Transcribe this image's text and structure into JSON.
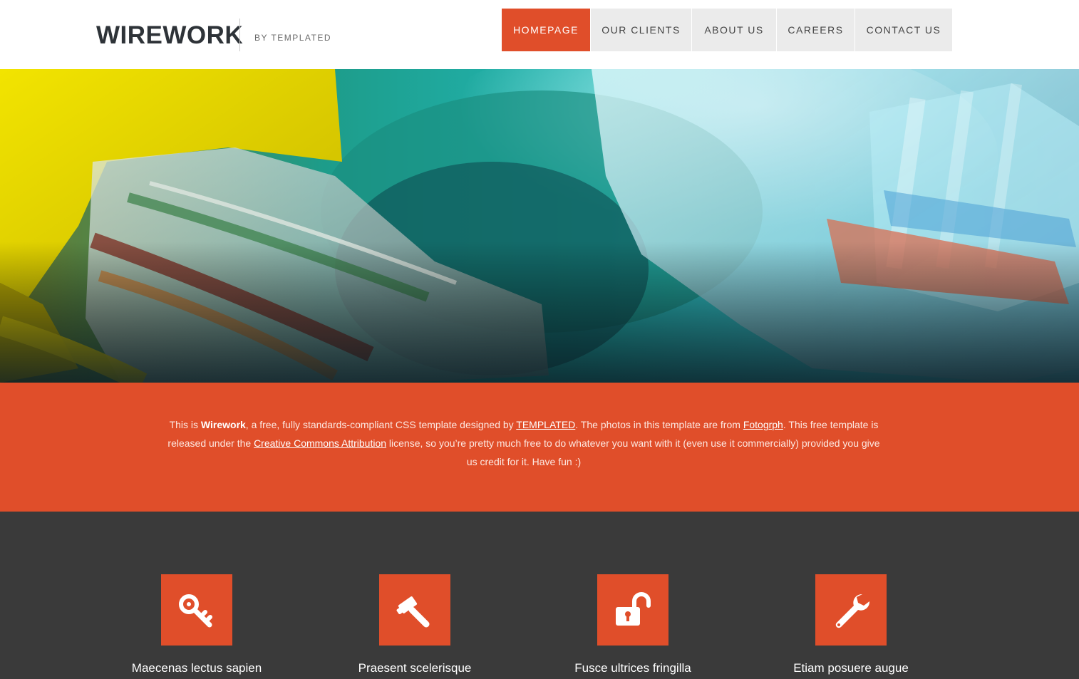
{
  "header": {
    "logo": "WIREWORK",
    "byline": "BY TEMPLATED"
  },
  "nav": {
    "items": [
      {
        "label": "HOMEPAGE"
      },
      {
        "label": "OUR CLIENTS"
      },
      {
        "label": "ABOUT US"
      },
      {
        "label": "CAREERS"
      },
      {
        "label": "CONTACT US"
      }
    ],
    "active": "HOMEPAGE"
  },
  "intro": {
    "p1": "This is ",
    "brand": "Wirework",
    "p2": ", a free, fully standards-compliant CSS template designed by ",
    "link_templated": "TEMPLATED",
    "p3": ". The photos in this template are from ",
    "link_fotogrph": "Fotogrph",
    "p4": ". This free template is released under the ",
    "link_cc": "Creative Commons Attribution",
    "p5": " license, so you’re pretty much free to do whatever you want with it (even use it commercially) provided you give us credit for it. Have fun :)"
  },
  "features": [
    {
      "title": "Maecenas lectus sapien",
      "icon": "key-icon"
    },
    {
      "title": "Praesent scelerisque",
      "icon": "gavel-icon"
    },
    {
      "title": "Fusce ultrices fringilla",
      "icon": "unlock-icon"
    },
    {
      "title": "Etiam posuere augue",
      "icon": "wrench-icon"
    }
  ],
  "colors": {
    "accent": "#e04e2a",
    "dark": "#3a3a3a",
    "nav_bg": "#ebebeb",
    "logo": "#2e3338"
  }
}
